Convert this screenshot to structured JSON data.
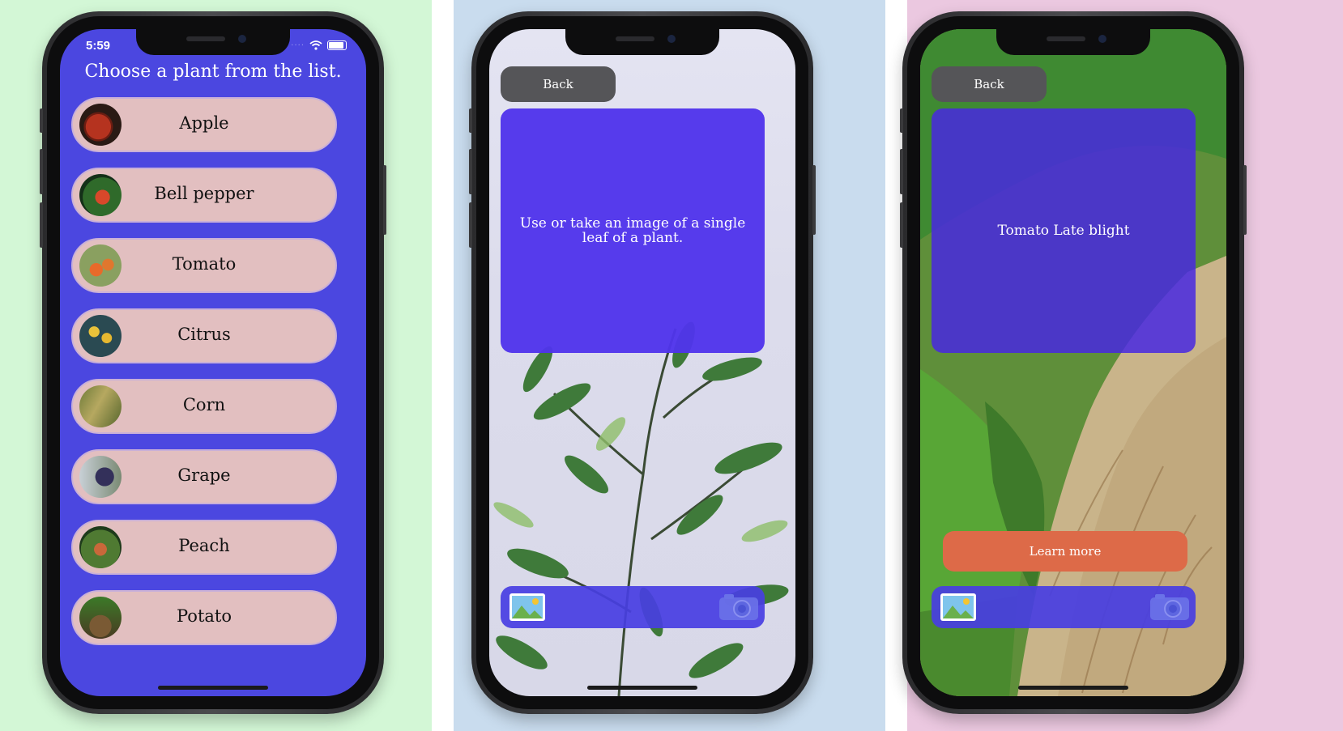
{
  "screen_list": {
    "status_time": "5:59",
    "title": "Choose a plant from the list.",
    "plants": [
      {
        "name": "Apple"
      },
      {
        "name": "Bell pepper"
      },
      {
        "name": "Tomato"
      },
      {
        "name": "Citrus"
      },
      {
        "name": "Corn"
      },
      {
        "name": "Grape"
      },
      {
        "name": "Peach"
      },
      {
        "name": "Potato"
      }
    ]
  },
  "screen_capture": {
    "back_label": "Back",
    "instruction": "Use or take an image of a single leaf of a plant.",
    "toolbar": {
      "left_icon": "photo-library-icon",
      "right_icon": "camera-icon"
    }
  },
  "screen_result": {
    "back_label": "Back",
    "result_text": "Tomato Late blight",
    "learn_more_label": "Learn more",
    "toolbar": {
      "left_icon": "photo-library-icon",
      "right_icon": "camera-icon"
    }
  },
  "colors": {
    "panel_left": "#d3f7d6",
    "panel_middle": "#c9dcee",
    "panel_right": "#ebc8e0",
    "list_background": "#4b47e0",
    "pill": "#e2bfc0",
    "card": "#5034eb",
    "back_button": "#555558",
    "learn_more_button": "#dd6a48"
  }
}
